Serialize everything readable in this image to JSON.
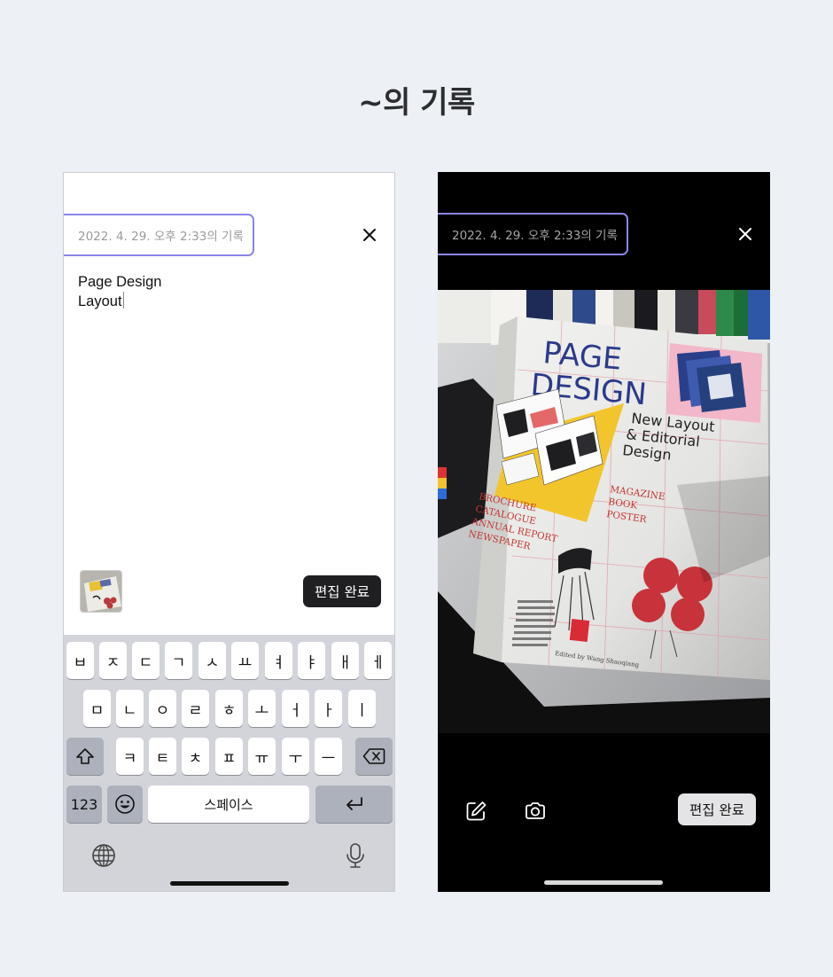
{
  "page": {
    "title": "~의 기록"
  },
  "left": {
    "date_label": "2022. 4. 29. 오후 2:33의 기록",
    "memo_lines": [
      "Page Design",
      "Layout"
    ],
    "done_label": "편집 완료",
    "keyboard": {
      "row1": [
        "ㅂ",
        "ㅈ",
        "ㄷ",
        "ㄱ",
        "ㅅ",
        "ㅛ",
        "ㅕ",
        "ㅑ",
        "ㅐ",
        "ㅔ"
      ],
      "row2": [
        "ㅁ",
        "ㄴ",
        "ㅇ",
        "ㄹ",
        "ㅎ",
        "ㅗ",
        "ㅓ",
        "ㅏ",
        "ㅣ"
      ],
      "row3": [
        "ㅋ",
        "ㅌ",
        "ㅊ",
        "ㅍ",
        "ㅠ",
        "ㅜ",
        "ㅡ"
      ],
      "num_label": "123",
      "space_label": "스페이스"
    }
  },
  "right": {
    "date_label": "2022. 4. 29. 오후 2:33의 기록",
    "done_label": "편집 완료",
    "book": {
      "title_line1": "PAGE",
      "title_line2": "DESIGN",
      "subtitle_line1": "New Layout",
      "subtitle_line2": "& Editorial",
      "subtitle_line3": "Design",
      "list_left": [
        "BROCHURE",
        "CATALOGUE",
        "ANNUAL REPORT",
        "NEWSPAPER"
      ],
      "list_right": [
        "MAGAZINE",
        "BOOK",
        "POSTER"
      ],
      "editor": "Edited by Wang Shaoqiang"
    }
  },
  "colors": {
    "accent": "#8a86e8",
    "button_dark": "#1f1f21",
    "button_light": "#e4e4e6"
  },
  "icons": [
    "close-icon",
    "shift-icon",
    "backspace-icon",
    "emoji-icon",
    "return-icon",
    "globe-icon",
    "mic-icon",
    "edit-icon",
    "camera-icon"
  ]
}
